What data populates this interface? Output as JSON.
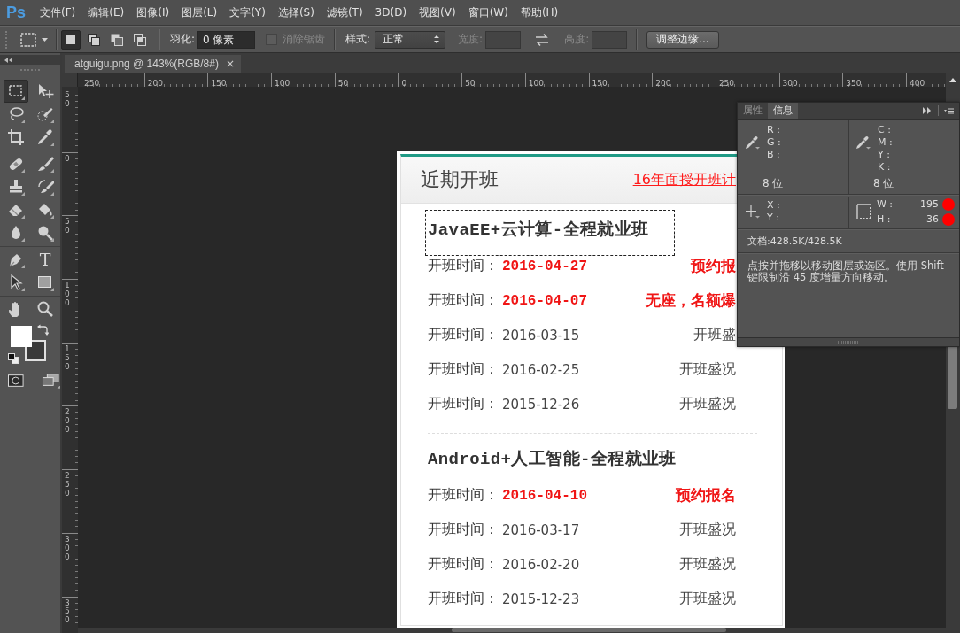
{
  "menu_bar": {
    "logo": "Ps",
    "items": [
      "文件(F)",
      "编辑(E)",
      "图像(I)",
      "图层(L)",
      "文字(Y)",
      "选择(S)",
      "滤镜(T)",
      "3D(D)",
      "视图(V)",
      "窗口(W)",
      "帮助(H)"
    ]
  },
  "options_bar": {
    "mode_buttons": [
      {
        "kind": "new",
        "selected": true
      },
      {
        "kind": "add",
        "selected": false
      },
      {
        "kind": "subtract",
        "selected": false
      },
      {
        "kind": "intersect",
        "selected": false
      }
    ],
    "feather": {
      "label": "羽化:",
      "value": "0 像素"
    },
    "anti_alias": {
      "label": "消除锯齿",
      "checked": false,
      "disabled": true
    },
    "style": {
      "label": "样式:",
      "value": "正常"
    },
    "width": {
      "label": "宽度:",
      "disabled": true
    },
    "height": {
      "label": "高度:",
      "disabled": true
    },
    "refine_button": "调整边缘..."
  },
  "document_tab": {
    "title": "atguigu.png @ 143%(RGB/8#)",
    "close": "×"
  },
  "rulers": {
    "horizontal": [
      "250",
      "200",
      "150",
      "100",
      "50",
      "0",
      "50",
      "100",
      "150",
      "200",
      "250",
      "300",
      "350",
      "400"
    ],
    "vertical": [
      "50",
      "0",
      "50",
      "100",
      "150",
      "200",
      "250",
      "300",
      "350"
    ]
  },
  "tool_groups": [
    [
      {
        "kind": "marquee",
        "selected": true
      },
      {
        "kind": "move",
        "selected": false
      },
      {
        "kind": "lasso",
        "selected": false
      },
      {
        "kind": "quickselect",
        "selected": false
      },
      {
        "kind": "crop",
        "selected": false
      },
      {
        "kind": "eyedropper",
        "selected": false
      }
    ],
    [
      {
        "kind": "healing",
        "selected": false
      },
      {
        "kind": "brush",
        "selected": false
      },
      {
        "kind": "stamp",
        "selected": false
      },
      {
        "kind": "historybrush",
        "selected": false
      },
      {
        "kind": "eraser",
        "selected": false
      },
      {
        "kind": "bucket",
        "selected": false
      },
      {
        "kind": "blur",
        "selected": false
      },
      {
        "kind": "dodge",
        "selected": false
      }
    ],
    [
      {
        "kind": "pen",
        "selected": false
      },
      {
        "kind": "type",
        "glyph": "T",
        "selected": false
      },
      {
        "kind": "pathselect",
        "selected": false
      },
      {
        "kind": "rectangle",
        "selected": false
      }
    ],
    [
      {
        "kind": "hand",
        "selected": false
      },
      {
        "kind": "zoom",
        "selected": false
      }
    ]
  ],
  "document": {
    "header": {
      "title": "近期开班",
      "link": "16年面授开班计"
    },
    "sections": [
      {
        "title": "JavaEE+云计算-全程就业班",
        "rows": [
          {
            "label": "开班时间：",
            "date": "2016-04-27",
            "action": "预约报",
            "featured": true
          },
          {
            "label": "开班时间：",
            "date": "2016-04-07",
            "action": "无座，名额爆",
            "featured": true
          },
          {
            "label": "开班时间：",
            "date": "2016-03-15",
            "action": "开班盛",
            "featured": false
          },
          {
            "label": "开班时间：",
            "date": "2016-02-25",
            "action": "开班盛况",
            "featured": false
          },
          {
            "label": "开班时间：",
            "date": "2015-12-26",
            "action": "开班盛况",
            "featured": false
          }
        ]
      },
      {
        "title": "Android+人工智能-全程就业班",
        "rows": [
          {
            "label": "开班时间：",
            "date": "2016-04-10",
            "action": "预约报名",
            "featured": true
          },
          {
            "label": "开班时间：",
            "date": "2016-03-17",
            "action": "开班盛况",
            "featured": false
          },
          {
            "label": "开班时间：",
            "date": "2016-02-20",
            "action": "开班盛况",
            "featured": false
          },
          {
            "label": "开班时间：",
            "date": "2015-12-23",
            "action": "开班盛况",
            "featured": false
          }
        ]
      }
    ]
  },
  "info_panel": {
    "tabs": [
      {
        "label": "属性",
        "selected": false
      },
      {
        "label": "信息",
        "selected": true
      }
    ],
    "color_readouts": [
      {
        "labels": [
          "R :",
          "G :",
          "B :"
        ],
        "depth": "8 位"
      },
      {
        "labels": [
          "C :",
          "M :",
          "Y :",
          "K :"
        ],
        "depth": "8 位"
      }
    ],
    "position": {
      "labels": [
        "X :",
        "Y :"
      ]
    },
    "size": [
      {
        "label": "W :",
        "value": "195"
      },
      {
        "label": "H :",
        "value": "36"
      }
    ],
    "document_size": "文档:428.5K/428.5K",
    "hint": "点按并拖移以移动图层或选区。使用 Shift 键限制沿 45 度增量方向移动。"
  }
}
